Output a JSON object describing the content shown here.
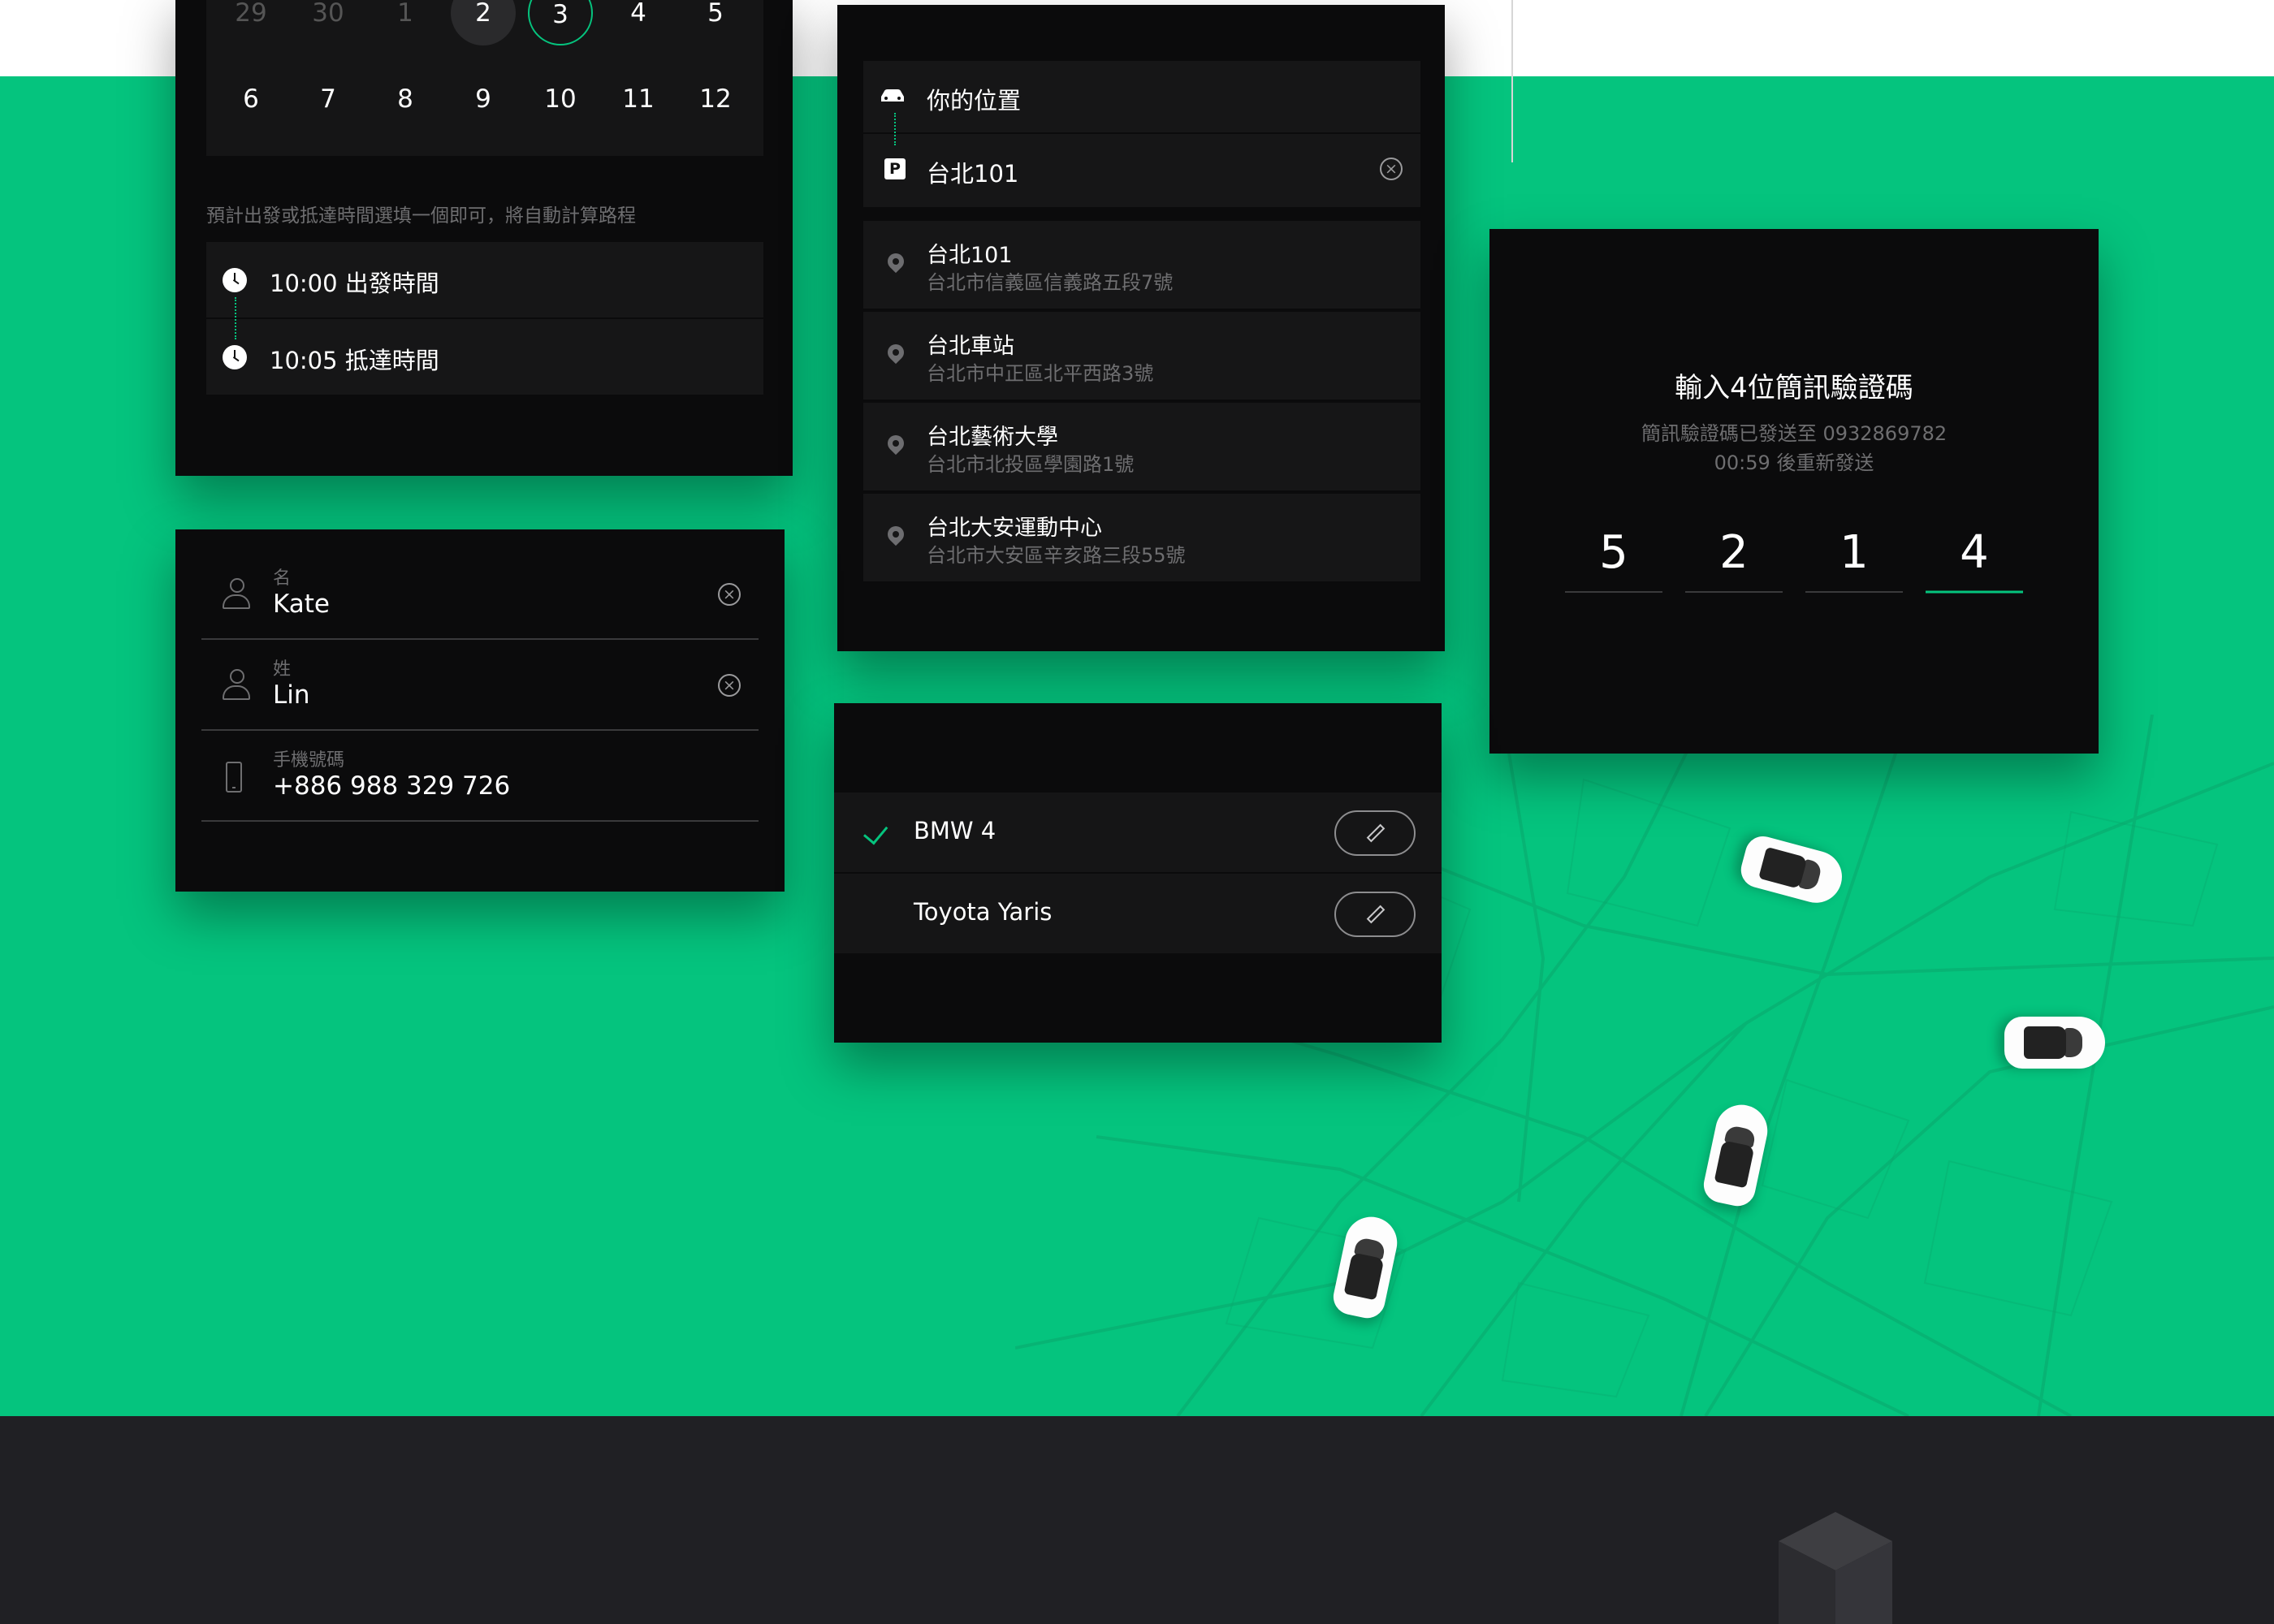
{
  "colors": {
    "accent_green": "#05c47e",
    "card_bg": "#0b0b0c",
    "row_bg": "#161617",
    "muted_text": "#6e6e70",
    "footer_bg": "#202024"
  },
  "calendar": {
    "row1": [
      "29",
      "30",
      "1",
      "2",
      "3",
      "4",
      "5"
    ],
    "row2": [
      "6",
      "7",
      "8",
      "9",
      "10",
      "11",
      "12"
    ],
    "hint": "預計出發或抵達時間選填一個即可，將自動計算路程",
    "depart_label": "10:00 出發時間",
    "arrive_label": "10:05 抵達時間"
  },
  "location": {
    "origin": "你的位置",
    "destination": "台北101",
    "suggestions": [
      {
        "name": "台北101",
        "address": "台北市信義區信義路五段7號"
      },
      {
        "name": "台北車站",
        "address": "台北市中正區北平西路3號"
      },
      {
        "name": "台北藝術大學",
        "address": "台北市北投區學園路1號"
      },
      {
        "name": "台北大安運動中心",
        "address": "台北市大安區辛亥路三段55號"
      }
    ]
  },
  "verification": {
    "title": "輸入4位簡訊驗證碼",
    "sent_to": "簡訊驗證碼已發送至 0932869782",
    "resend": "00:59 後重新發送",
    "digits": [
      "5",
      "2",
      "1",
      "4"
    ]
  },
  "profile": {
    "first_name_label": "名",
    "first_name": "Kate",
    "last_name_label": "姓",
    "last_name": "Lin",
    "phone_label": "手機號碼",
    "phone": "+886 988 329 726"
  },
  "cars": {
    "items": [
      {
        "name": "BMW 4",
        "selected": true
      },
      {
        "name": "Toyota Yaris",
        "selected": false
      }
    ]
  },
  "icons": [
    "car-icon",
    "parking-icon",
    "clear-icon",
    "clock-icon",
    "location-pin-icon",
    "person-icon",
    "phone-icon",
    "check-icon",
    "pencil-icon",
    "box-icon"
  ]
}
